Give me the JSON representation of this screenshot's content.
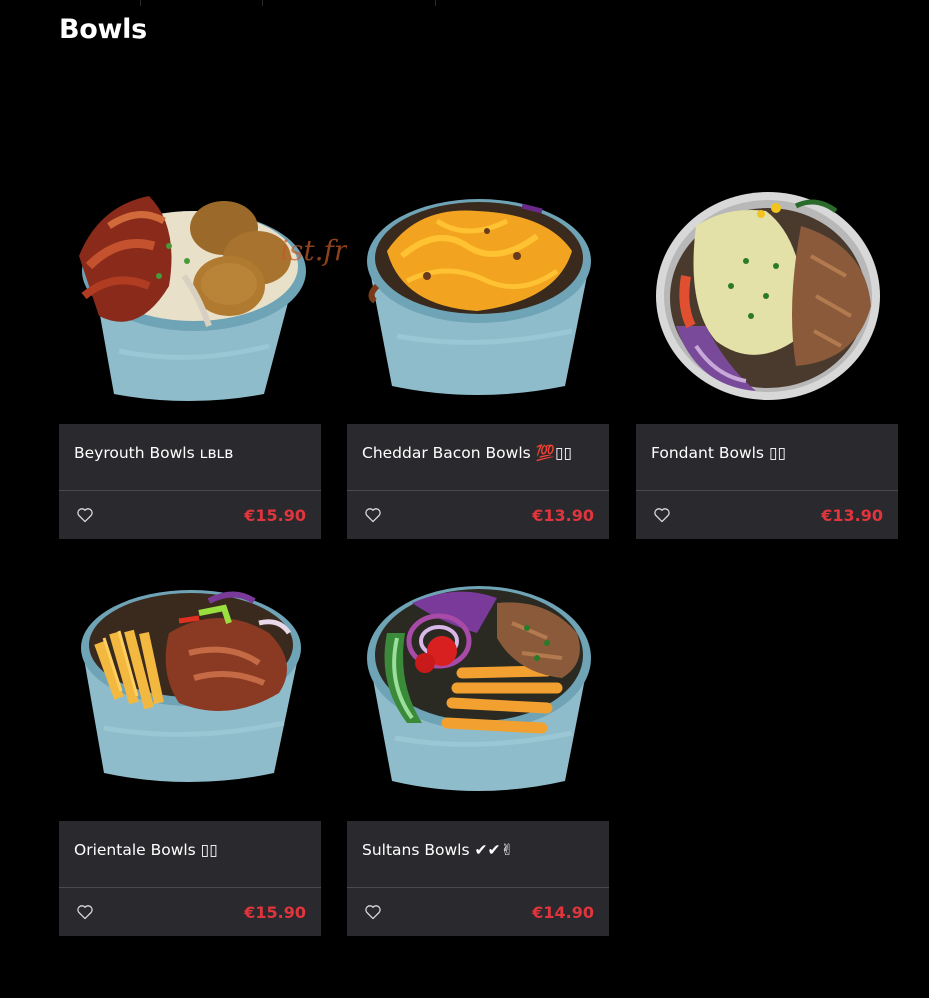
{
  "section": {
    "title": "Bowls"
  },
  "watermark": "ist.fr",
  "colors": {
    "background": "#000000",
    "card": "#2a292d",
    "price": "#e0353d",
    "bowl": "#8fbccb"
  },
  "products": [
    {
      "name": "Beyrouth Bowls ʟʙʟʙ",
      "price": "€15.90",
      "image": "bowl-falafel-bacon"
    },
    {
      "name": "Cheddar Bacon Bowls 💯▯▯",
      "price": "€13.90",
      "image": "bowl-cheddar-sauce"
    },
    {
      "name": "Fondant Bowls ▯▯",
      "price": "€13.90",
      "image": "bowl-melted-cheese"
    },
    {
      "name": "Orientale Bowls ▯▯",
      "price": "€15.90",
      "image": "bowl-fries-meat"
    },
    {
      "name": "Sultans Bowls ✔✔✌",
      "price": "€14.90",
      "image": "bowl-veg-fries"
    }
  ],
  "icons": {
    "favorite": "heart-outline-icon"
  }
}
